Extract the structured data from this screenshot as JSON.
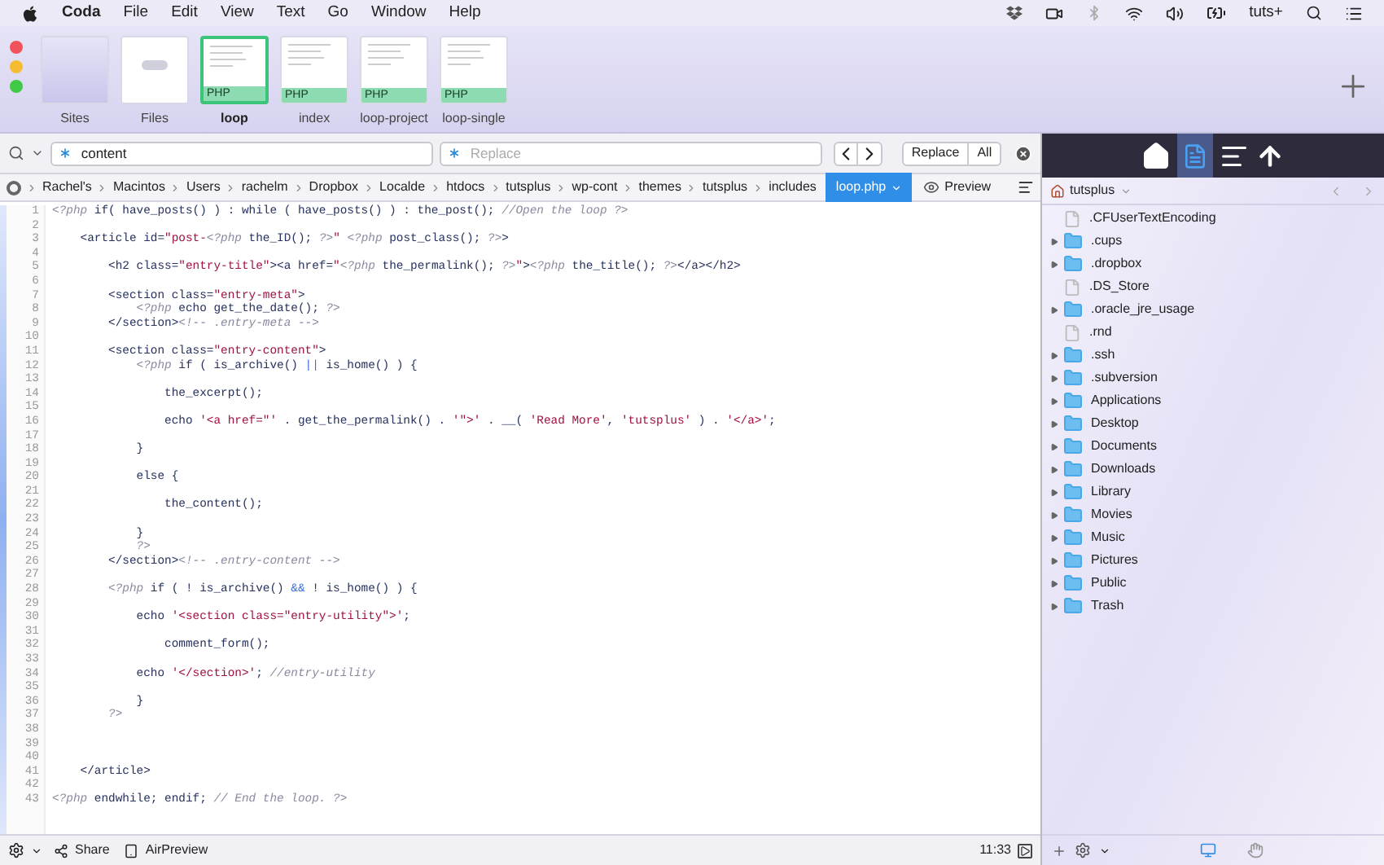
{
  "menubar": {
    "app": "Coda",
    "items": [
      "File",
      "Edit",
      "View",
      "Text",
      "Go",
      "Window",
      "Help"
    ],
    "user": "tuts+"
  },
  "toolbar": {
    "tabs": [
      {
        "kind": "sites",
        "label": "Sites",
        "selected": false
      },
      {
        "kind": "files",
        "label": "Files",
        "selected": false
      },
      {
        "kind": "doc",
        "label": "loop",
        "badge": "PHP",
        "selected": true
      },
      {
        "kind": "doc",
        "label": "index",
        "badge": "PHP",
        "selected": false
      },
      {
        "kind": "doc",
        "label": "loop-project",
        "badge": "PHP",
        "selected": false
      },
      {
        "kind": "doc",
        "label": "loop-single",
        "badge": "PHP",
        "selected": false
      }
    ]
  },
  "find": {
    "value": "content",
    "replace_placeholder": "Replace",
    "buttons": [
      "Replace",
      "All"
    ]
  },
  "breadcrumb": {
    "items": [
      "Rachel's",
      "Macintos",
      "Users",
      "rachelm",
      "Dropbox",
      "Localde",
      "htdocs",
      "tutsplus",
      "wp-cont",
      "themes",
      "tutsplus",
      "includes"
    ],
    "current": "loop.php",
    "preview": "Preview"
  },
  "editor": {
    "lines": [
      {
        "number": "1",
        "parts": [
          {
            "kind": "php",
            "text": "<?php"
          },
          {
            "kind": "code",
            "text": " if( have_posts() ) : while ( have_posts() ) : the_post(); "
          },
          {
            "kind": "comment",
            "text": "//Open the loop ?>"
          }
        ]
      },
      {
        "number": "2"
      },
      {
        "number": "3",
        "parts": [
          {
            "kind": "code",
            "text": "    <article id="
          },
          {
            "kind": "string",
            "text": "\"post-"
          },
          {
            "kind": "php",
            "text": "<?php"
          },
          {
            "kind": "code",
            "text": " the_ID(); "
          },
          {
            "kind": "php",
            "text": "?>"
          },
          {
            "kind": "string",
            "text": "\""
          },
          {
            "kind": "php",
            "text": " <?php"
          },
          {
            "kind": "code",
            "text": " post_class(); "
          },
          {
            "kind": "php",
            "text": "?>"
          },
          {
            "kind": "code",
            "text": ">"
          }
        ]
      },
      {
        "number": "4"
      },
      {
        "number": "5",
        "parts": [
          {
            "kind": "code",
            "text": "        <h2 class="
          },
          {
            "kind": "string",
            "text": "\"entry-title\""
          },
          {
            "kind": "code",
            "text": "><a href="
          },
          {
            "kind": "string",
            "text": "\""
          },
          {
            "kind": "php",
            "text": "<?php"
          },
          {
            "kind": "code",
            "text": " the_permalink(); "
          },
          {
            "kind": "php",
            "text": "?>"
          },
          {
            "kind": "string",
            "text": "\""
          },
          {
            "kind": "code",
            "text": ">"
          },
          {
            "kind": "php",
            "text": "<?php"
          },
          {
            "kind": "code",
            "text": " the_title(); "
          },
          {
            "kind": "php",
            "text": "?>"
          },
          {
            "kind": "code",
            "text": "</a></h2>"
          }
        ]
      },
      {
        "number": "6"
      },
      {
        "number": "7",
        "parts": [
          {
            "kind": "code",
            "text": "        <section class="
          },
          {
            "kind": "string",
            "text": "\"entry-meta\""
          },
          {
            "kind": "code",
            "text": ">"
          }
        ]
      },
      {
        "number": "8",
        "parts": [
          {
            "kind": "php",
            "text": "            <?php"
          },
          {
            "kind": "code",
            "text": " echo get_the_date(); "
          },
          {
            "kind": "php",
            "text": "?>"
          }
        ]
      },
      {
        "number": "9",
        "parts": [
          {
            "kind": "code",
            "text": "        </section>"
          },
          {
            "kind": "comment",
            "text": "<!-- .entry-meta -->"
          }
        ]
      },
      {
        "number": "10"
      },
      {
        "number": "11",
        "parts": [
          {
            "kind": "code",
            "text": "        <section class="
          },
          {
            "kind": "string",
            "text": "\"entry-content\""
          },
          {
            "kind": "code",
            "text": ">"
          }
        ]
      },
      {
        "number": "12",
        "parts": [
          {
            "kind": "php",
            "text": "            <?php"
          },
          {
            "kind": "code",
            "text": " if ( is_archive() "
          },
          {
            "kind": "op",
            "text": "||"
          },
          {
            "kind": "code",
            "text": " is_home() ) {"
          }
        ]
      },
      {
        "number": "13"
      },
      {
        "number": "14",
        "parts": [
          {
            "kind": "code",
            "text": "                the_excerpt();"
          }
        ]
      },
      {
        "number": "15"
      },
      {
        "number": "16",
        "parts": [
          {
            "kind": "code",
            "text": "                echo "
          },
          {
            "kind": "string",
            "text": "'<a href=\"'"
          },
          {
            "kind": "code",
            "text": " . get_the_permalink() . "
          },
          {
            "kind": "string",
            "text": "'\">'"
          },
          {
            "kind": "code",
            "text": " . __( "
          },
          {
            "kind": "string",
            "text": "'Read More'"
          },
          {
            "kind": "code",
            "text": ", "
          },
          {
            "kind": "string",
            "text": "'tutsplus'"
          },
          {
            "kind": "code",
            "text": " ) . "
          },
          {
            "kind": "string",
            "text": "'</a>'"
          },
          {
            "kind": "code",
            "text": ";"
          }
        ]
      },
      {
        "number": "17"
      },
      {
        "number": "18",
        "parts": [
          {
            "kind": "code",
            "text": "            }"
          }
        ]
      },
      {
        "number": "19"
      },
      {
        "number": "20",
        "parts": [
          {
            "kind": "code",
            "text": "            else {"
          }
        ]
      },
      {
        "number": "21"
      },
      {
        "number": "22",
        "parts": [
          {
            "kind": "code",
            "text": "                the_content();"
          }
        ]
      },
      {
        "number": "23"
      },
      {
        "number": "24",
        "parts": [
          {
            "kind": "code",
            "text": "            }"
          }
        ]
      },
      {
        "number": "25",
        "parts": [
          {
            "kind": "php",
            "text": "            ?>"
          }
        ]
      },
      {
        "number": "26",
        "parts": [
          {
            "kind": "code",
            "text": "        </section>"
          },
          {
            "kind": "comment",
            "text": "<!-- .entry-content -->"
          }
        ]
      },
      {
        "number": "27"
      },
      {
        "number": "28",
        "parts": [
          {
            "kind": "php",
            "text": "        <?php"
          },
          {
            "kind": "code",
            "text": " if ( ! is_archive() "
          },
          {
            "kind": "op",
            "text": "&&"
          },
          {
            "kind": "code",
            "text": " ! is_home() ) {"
          }
        ]
      },
      {
        "number": "29"
      },
      {
        "number": "30",
        "parts": [
          {
            "kind": "code",
            "text": "            echo "
          },
          {
            "kind": "string",
            "text": "'<section class=\"entry-utility\">'"
          },
          {
            "kind": "code",
            "text": ";"
          }
        ]
      },
      {
        "number": "31"
      },
      {
        "number": "32",
        "parts": [
          {
            "kind": "code",
            "text": "                comment_form();"
          }
        ]
      },
      {
        "number": "33"
      },
      {
        "number": "34",
        "parts": [
          {
            "kind": "code",
            "text": "            echo "
          },
          {
            "kind": "string",
            "text": "'</section>'"
          },
          {
            "kind": "code",
            "text": "; "
          },
          {
            "kind": "comment",
            "text": "//entry-utility"
          }
        ]
      },
      {
        "number": "35"
      },
      {
        "number": "36",
        "parts": [
          {
            "kind": "code",
            "text": "            }"
          }
        ]
      },
      {
        "number": "37",
        "parts": [
          {
            "kind": "php",
            "text": "        ?>"
          }
        ]
      },
      {
        "number": "38"
      },
      {
        "number": "39"
      },
      {
        "number": "40"
      },
      {
        "number": "41",
        "parts": [
          {
            "kind": "code",
            "text": "    </article>"
          }
        ]
      },
      {
        "number": "42"
      },
      {
        "number": "43",
        "parts": [
          {
            "kind": "php",
            "text": "<?php"
          },
          {
            "kind": "code",
            "text": " endwhile; endif; "
          },
          {
            "kind": "comment",
            "text": "// End the loop. ?>"
          }
        ]
      }
    ]
  },
  "files": {
    "root": "tutsplus",
    "items": [
      {
        "kind": "file",
        "name": ".CFUserTextEncoding"
      },
      {
        "kind": "folder",
        "name": ".cups"
      },
      {
        "kind": "folder",
        "name": ".dropbox"
      },
      {
        "kind": "file",
        "name": ".DS_Store"
      },
      {
        "kind": "folder",
        "name": ".oracle_jre_usage"
      },
      {
        "kind": "file",
        "name": ".rnd"
      },
      {
        "kind": "folder",
        "name": ".ssh"
      },
      {
        "kind": "folder",
        "name": ".subversion"
      },
      {
        "kind": "folder",
        "name": "Applications"
      },
      {
        "kind": "folder",
        "name": "Desktop"
      },
      {
        "kind": "folder",
        "name": "Documents"
      },
      {
        "kind": "folder",
        "name": "Downloads"
      },
      {
        "kind": "folder",
        "name": "Library"
      },
      {
        "kind": "folder",
        "name": "Movies"
      },
      {
        "kind": "folder",
        "name": "Music"
      },
      {
        "kind": "folder",
        "name": "Pictures"
      },
      {
        "kind": "folder",
        "name": "Public"
      },
      {
        "kind": "folder",
        "name": "Trash"
      }
    ]
  },
  "status_bar": {
    "share": "Share",
    "airpreview": "AirPreview",
    "position": "11:33"
  }
}
